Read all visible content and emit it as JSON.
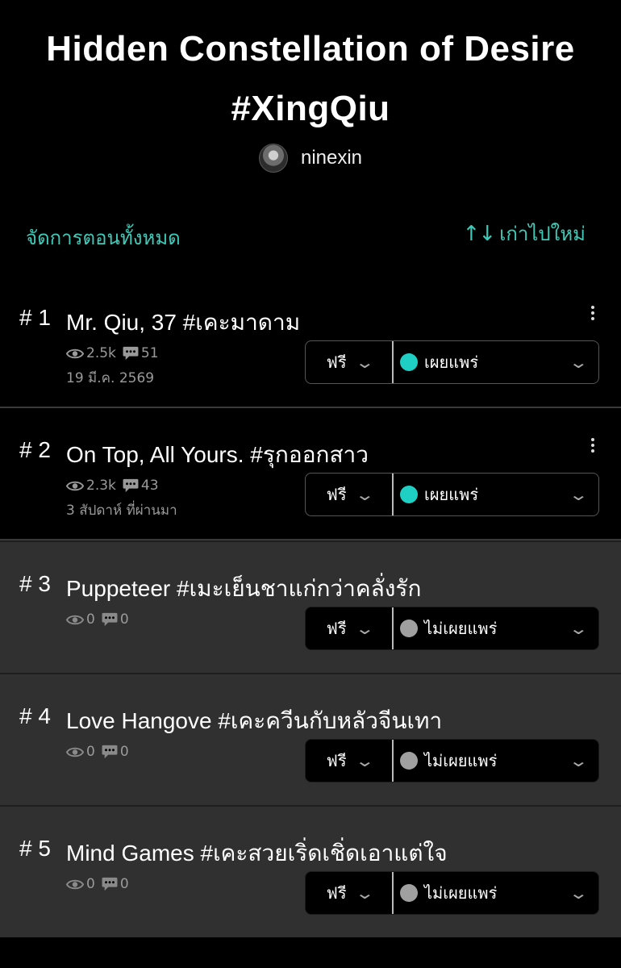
{
  "story": {
    "title_line1": "Hidden Constellation of Desire",
    "title_line2": "#XingQiu",
    "author": "ninexin"
  },
  "toolbar": {
    "manage_label": "จัดการตอนทั้งหมด",
    "sort_icon": "↑↓",
    "sort_label": "เก่าไปใหม่"
  },
  "colors": {
    "accent": "#3fc9b8",
    "published_dot": "#1fcfc3",
    "unpublished_dot": "#a0a0a0"
  },
  "episodes": [
    {
      "num": "# 1",
      "title": "Mr. Qiu, 37 #เคะมาดาม",
      "views": "2.5k",
      "comments": "51",
      "date": "19 มี.ค. 2569",
      "price": "ฟรี",
      "status": "เผยแพร่",
      "published": true
    },
    {
      "num": "# 2",
      "title": "On Top, All Yours. #รุกออกสาว",
      "views": "2.3k",
      "comments": "43",
      "date": "3 สัปดาห์ ที่ผ่านมา",
      "price": "ฟรี",
      "status": "เผยแพร่",
      "published": true
    },
    {
      "num": "# 3",
      "title": "Puppeteer #เมะเย็นชาแก่กว่าคลั่งรัก",
      "views": "0",
      "comments": "0",
      "date": "",
      "price": "ฟรี",
      "status": "ไม่เผยแพร่",
      "published": false
    },
    {
      "num": "# 4",
      "title": "Love Hangove #เคะควีนกับหลัวจีนเทา",
      "views": "0",
      "comments": "0",
      "date": "",
      "price": "ฟรี",
      "status": "ไม่เผยแพร่",
      "published": false
    },
    {
      "num": "# 5",
      "title": "Mind Games #เคะสวยเริ่ดเชิ่ดเอาแต่ใจ",
      "views": "0",
      "comments": "0",
      "date": "",
      "price": "ฟรี",
      "status": "ไม่เผยแพร่",
      "published": false
    }
  ]
}
